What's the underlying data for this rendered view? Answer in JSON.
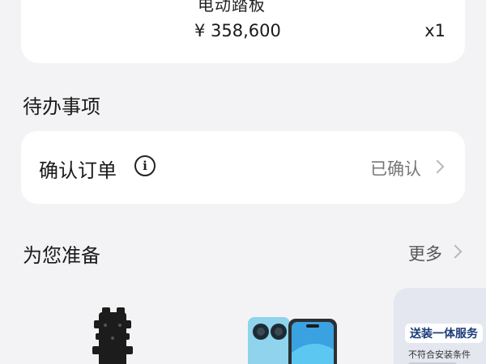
{
  "order": {
    "cut_text": "电动踏板",
    "price": "¥ 358,600",
    "quantity": "x1"
  },
  "todo": {
    "title": "待办事项",
    "item_label": "确认订单",
    "status": "已确认"
  },
  "prepared": {
    "title": "为您准备",
    "more": "更多",
    "promo_badge": "送装一体服务",
    "promo_sub": "不符合安装条件"
  },
  "colors": {
    "page_bg": "#f3f3f5",
    "card_bg": "#ffffff",
    "muted_text": "#777777",
    "promo_text": "#1a3a78"
  },
  "icons": [
    "info-icon",
    "chevron-right-icon"
  ]
}
